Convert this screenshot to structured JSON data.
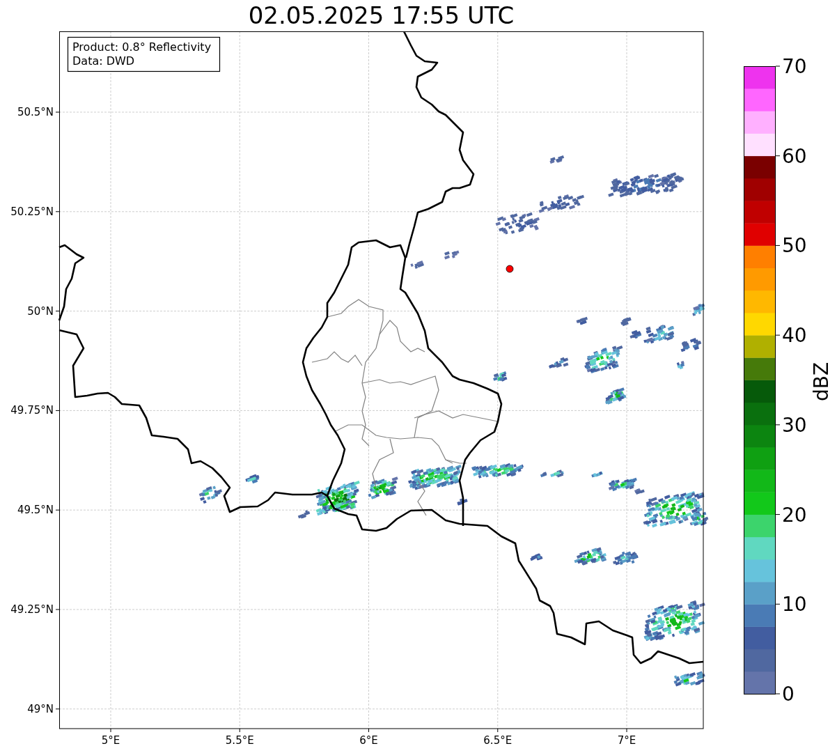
{
  "title": "02.05.2025 17:55 UTC",
  "info_box": {
    "lines": [
      "Product: 0.8° Reflectivity",
      "Data: DWD"
    ]
  },
  "map": {
    "lat_labels": [
      "50.5°N",
      "50.25°N",
      "50°N",
      "49.75°N",
      "49.5°N",
      "49.25°N",
      "49°N"
    ],
    "lon_labels": [
      "5°E",
      "5.5°E",
      "6°E",
      "6.5°E",
      "7°E"
    ]
  },
  "colorbar": {
    "label": "dBZ",
    "ticks": [
      "70",
      "60",
      "50",
      "40",
      "30",
      "20",
      "10",
      "0"
    ]
  }
}
